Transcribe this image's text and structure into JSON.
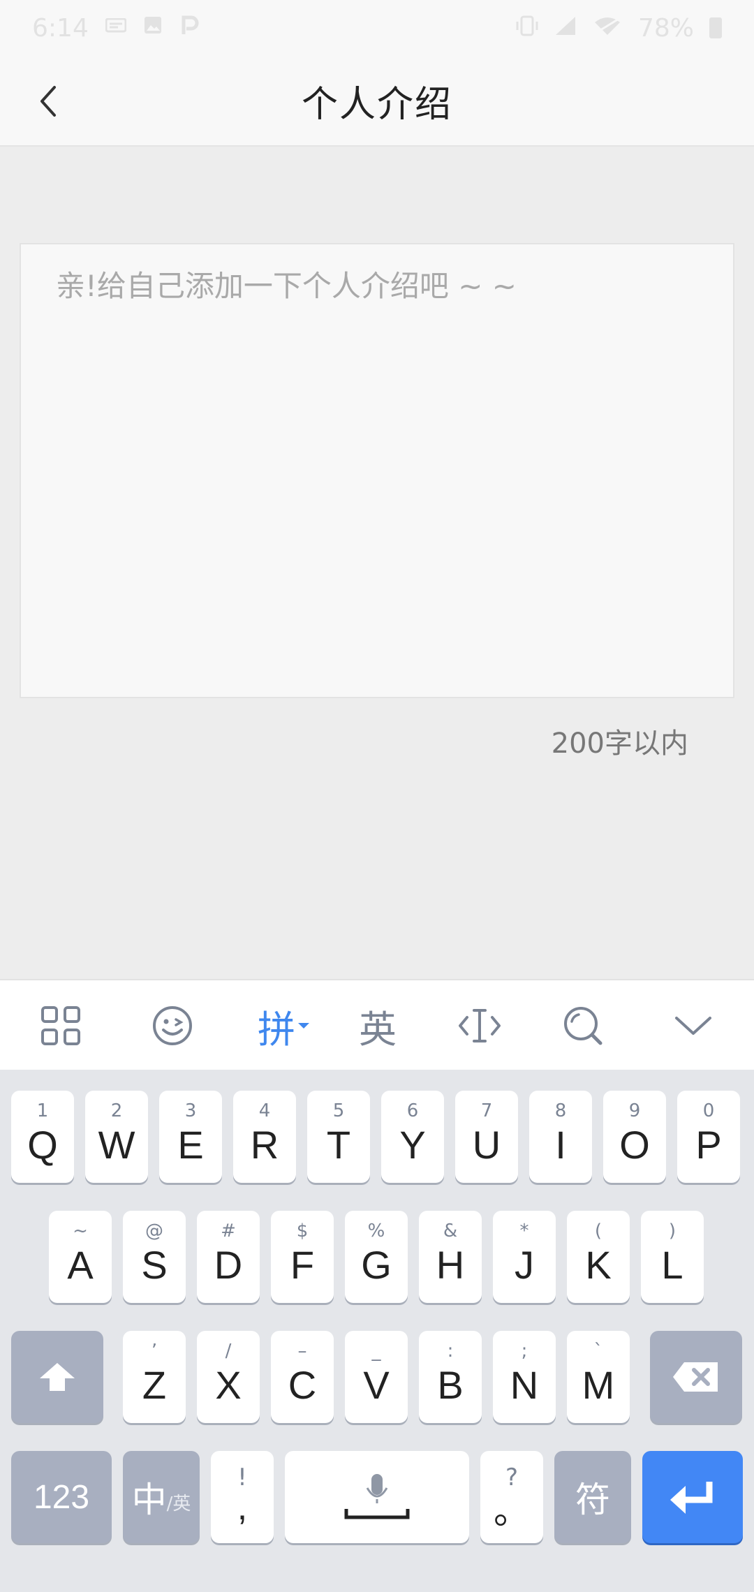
{
  "status_bar": {
    "time": "6:14",
    "battery": "78%",
    "icons": [
      "message-icon",
      "gallery-icon",
      "p-icon",
      "vibrate-icon",
      "signal-icon",
      "wifi-off-icon",
      "battery-icon"
    ]
  },
  "nav": {
    "back_icon": "back-chevron-icon",
    "title": "个人介绍"
  },
  "intro": {
    "placeholder": "亲!给自己添加一下个人介绍吧 ~ ~",
    "value": "",
    "limit_text": "200字以内"
  },
  "keyboard": {
    "toolbar": {
      "apps_icon": "grid-apps-icon",
      "emoji_icon": "emoji-icon",
      "pinyin_label": "拼",
      "english_label": "英",
      "cursor_icon": "cursor-move-icon",
      "search_icon": "search-icon",
      "hide_icon": "chevron-down-icon"
    },
    "row1": [
      {
        "main": "Q",
        "sub": "1"
      },
      {
        "main": "W",
        "sub": "2"
      },
      {
        "main": "E",
        "sub": "3"
      },
      {
        "main": "R",
        "sub": "4"
      },
      {
        "main": "T",
        "sub": "5"
      },
      {
        "main": "Y",
        "sub": "6"
      },
      {
        "main": "U",
        "sub": "7"
      },
      {
        "main": "I",
        "sub": "8"
      },
      {
        "main": "O",
        "sub": "9"
      },
      {
        "main": "P",
        "sub": "0"
      }
    ],
    "row2": [
      {
        "main": "A",
        "sub": "~"
      },
      {
        "main": "S",
        "sub": "@"
      },
      {
        "main": "D",
        "sub": "#"
      },
      {
        "main": "F",
        "sub": "$"
      },
      {
        "main": "G",
        "sub": "%"
      },
      {
        "main": "H",
        "sub": "&"
      },
      {
        "main": "J",
        "sub": "*"
      },
      {
        "main": "K",
        "sub": "("
      },
      {
        "main": "L",
        "sub": ")"
      }
    ],
    "row3": [
      {
        "main": "Z",
        "sub": "’"
      },
      {
        "main": "X",
        "sub": "/"
      },
      {
        "main": "C",
        "sub": "–"
      },
      {
        "main": "V",
        "sub": "_"
      },
      {
        "main": "B",
        "sub": ":"
      },
      {
        "main": "N",
        "sub": ";"
      },
      {
        "main": "M",
        "sub": "`"
      }
    ],
    "shift_icon": "shift-arrow-icon",
    "backspace_icon": "backspace-icon",
    "num_label": "123",
    "lang_main": "中",
    "lang_sub": "/英",
    "comma_main": ",",
    "comma_sub": "!",
    "space_icon": "microphone-icon",
    "period_main": "。",
    "period_sub": "?",
    "symbol_label": "符",
    "enter_icon": "enter-return-icon"
  }
}
